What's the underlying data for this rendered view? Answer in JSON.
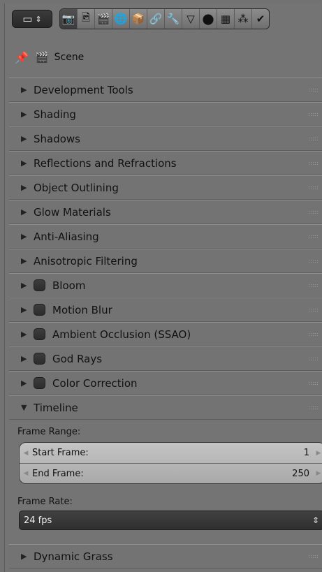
{
  "toolbar": {
    "editor_type": "🖥",
    "tabs": [
      {
        "icon": "render-icon",
        "glyph": "📷"
      },
      {
        "icon": "render-layers-icon",
        "glyph": "🖻"
      },
      {
        "icon": "scene-icon",
        "glyph": "🎬"
      },
      {
        "icon": "world-icon",
        "glyph": "🌐"
      },
      {
        "icon": "object-icon",
        "glyph": "📦"
      },
      {
        "icon": "constraints-icon",
        "glyph": "🔗"
      },
      {
        "icon": "modifiers-icon",
        "glyph": "🔧"
      },
      {
        "icon": "data-icon",
        "glyph": "▽"
      },
      {
        "icon": "material-icon",
        "glyph": "⬤"
      },
      {
        "icon": "texture-icon",
        "glyph": "▦"
      },
      {
        "icon": "particles-icon",
        "glyph": "⁂"
      },
      {
        "icon": "physics-icon",
        "glyph": "✔"
      }
    ]
  },
  "context": {
    "label": "Scene"
  },
  "sections": [
    {
      "title": "Development Tools",
      "checkbox": false
    },
    {
      "title": "Shading",
      "checkbox": false
    },
    {
      "title": "Shadows",
      "checkbox": false
    },
    {
      "title": "Reflections and Refractions",
      "checkbox": false
    },
    {
      "title": "Object Outlining",
      "checkbox": false
    },
    {
      "title": "Glow Materials",
      "checkbox": false
    },
    {
      "title": "Anti-Aliasing",
      "checkbox": false
    },
    {
      "title": "Anisotropic Filtering",
      "checkbox": false
    },
    {
      "title": "Bloom",
      "checkbox": true
    },
    {
      "title": "Motion Blur",
      "checkbox": true
    },
    {
      "title": "Ambient Occlusion (SSAO)",
      "checkbox": true
    },
    {
      "title": "God Rays",
      "checkbox": true
    },
    {
      "title": "Color Correction",
      "checkbox": true
    }
  ],
  "timeline": {
    "title": "Timeline",
    "frame_range_label": "Frame Range:",
    "start_frame_label": "Start Frame:",
    "start_frame_value": "1",
    "end_frame_label": "End Frame:",
    "end_frame_value": "250",
    "frame_rate_label": "Frame Rate:",
    "frame_rate_value": "24 fps"
  },
  "footer_section": {
    "title": "Dynamic Grass"
  }
}
